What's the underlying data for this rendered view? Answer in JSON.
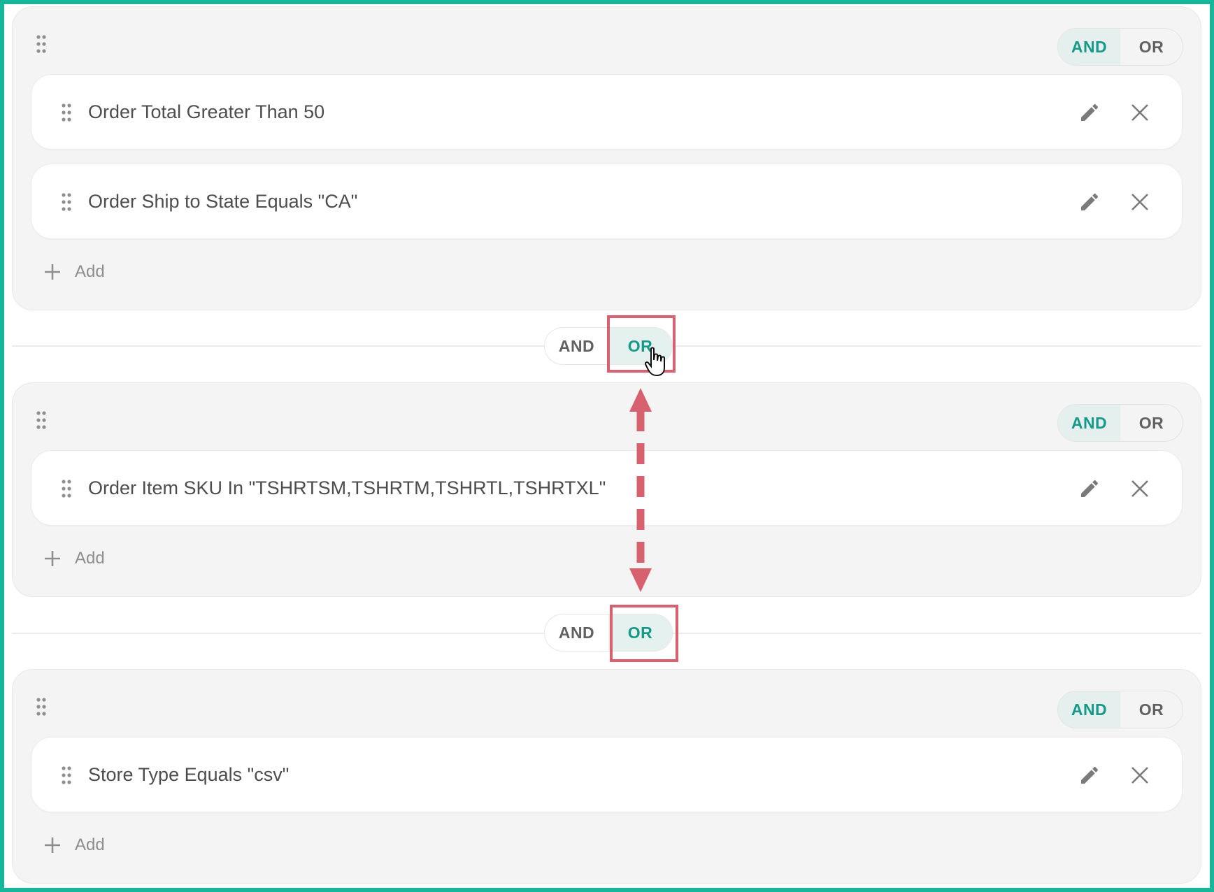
{
  "groups": [
    {
      "logic": {
        "and_label": "AND",
        "or_label": "OR",
        "selected": "AND"
      },
      "rules": [
        {
          "text": "Order Total Greater Than 50"
        },
        {
          "text": "Order Ship to State Equals \"CA\""
        }
      ],
      "add_label": "Add"
    },
    {
      "logic": {
        "and_label": "AND",
        "or_label": "OR",
        "selected": "AND"
      },
      "rules": [
        {
          "text": "Order Item SKU In \"TSHRTSM,TSHRTM,TSHRTL,TSHRTXL\""
        }
      ],
      "add_label": "Add"
    },
    {
      "logic": {
        "and_label": "AND",
        "or_label": "OR",
        "selected": "AND"
      },
      "rules": [
        {
          "text": "Store Type Equals \"csv\""
        }
      ],
      "add_label": "Add"
    }
  ],
  "separators": [
    {
      "and_label": "AND",
      "or_label": "OR",
      "selected": "OR"
    },
    {
      "and_label": "AND",
      "or_label": "OR",
      "selected": "OR"
    }
  ],
  "colors": {
    "frame": "#17b79b",
    "active_text": "#17998a",
    "active_bg": "#e5f1ef",
    "annotation": "#d8616f"
  }
}
